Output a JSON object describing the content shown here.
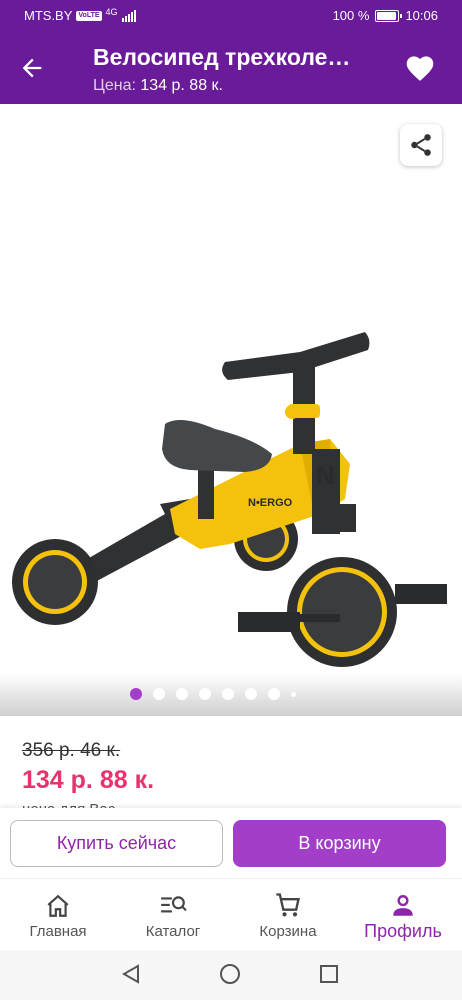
{
  "status_bar": {
    "carrier": "MTS.BY",
    "volte": "VoLTE",
    "network": "4G",
    "battery": "100 %",
    "battery_level": 1.0,
    "time": "10:06"
  },
  "app_bar": {
    "title": "Велосипед трехколе…",
    "price_label": "Цена:",
    "price_value": "134 р. 88 к.",
    "icons": {
      "back": "arrow-left-icon",
      "favorite": "heart-icon"
    }
  },
  "gallery": {
    "icons": {
      "share": "share-icon"
    },
    "brand_mark": "N•ERGO",
    "logo_letter": "N",
    "slide_count": 8,
    "active_slide": 1
  },
  "pricing": {
    "old_price": "356 р. 46 к.",
    "new_price": "134 р. 88 к.",
    "note": "цена для Вас"
  },
  "actions": {
    "buy_now": "Купить сейчас",
    "add_to_cart": "В корзину"
  },
  "bottom_nav": {
    "items": [
      {
        "label": "Главная",
        "icon": "home-icon"
      },
      {
        "label": "Каталог",
        "icon": "catalog-search-icon"
      },
      {
        "label": "Корзина",
        "icon": "cart-icon"
      },
      {
        "label": "Профиль",
        "icon": "profile-icon",
        "active": true
      }
    ]
  },
  "colors": {
    "brand": "#6a1b9a",
    "accent": "#a23ec8",
    "price": "#e8336d"
  }
}
